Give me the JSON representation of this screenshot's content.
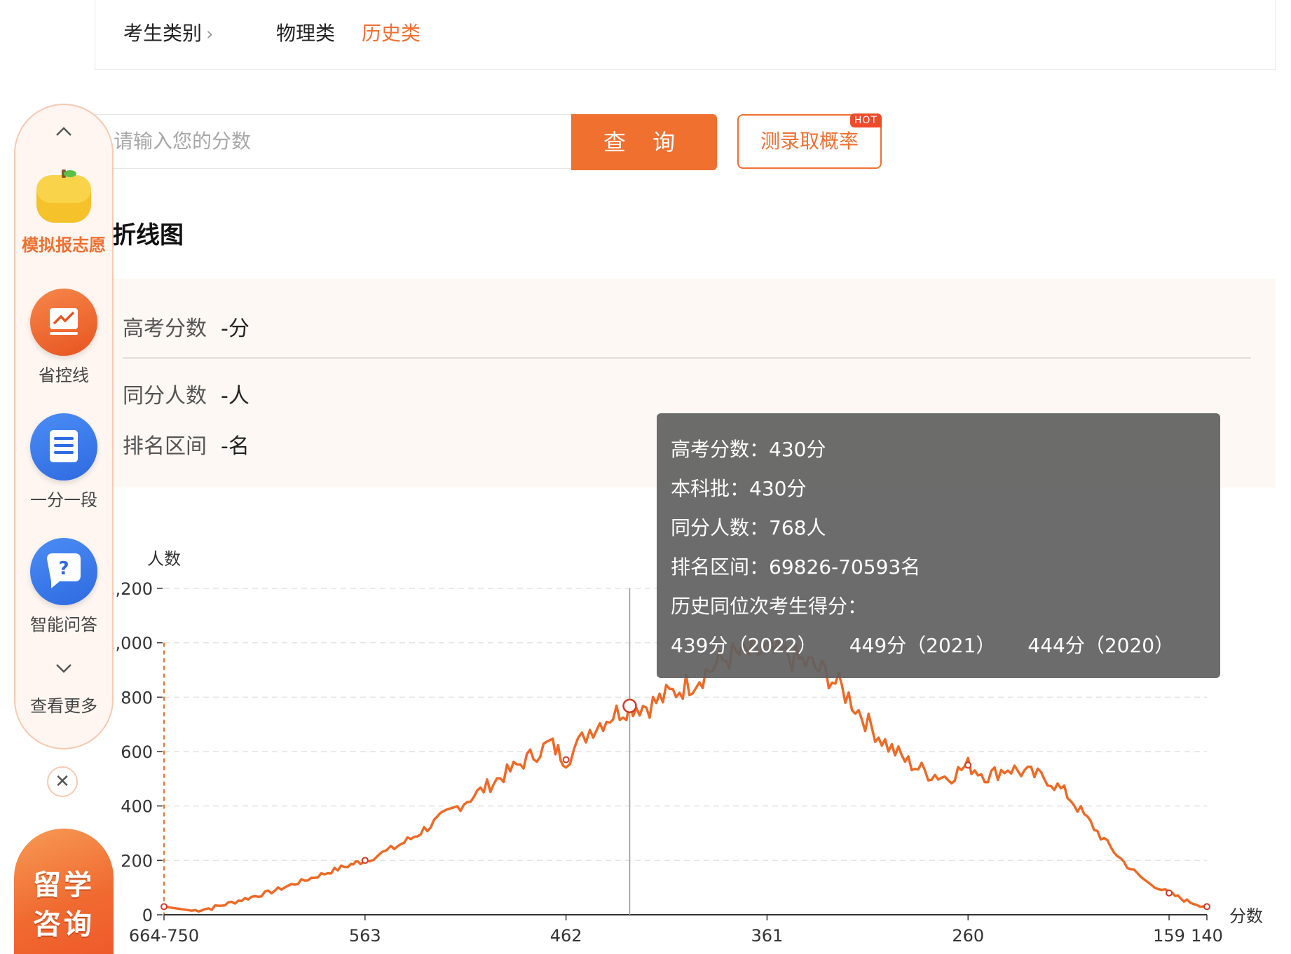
{
  "filter": {
    "label": "考生类别",
    "chevron": "›",
    "options": [
      "物理类",
      "历史类"
    ],
    "active_option": "历史类"
  },
  "search": {
    "placeholder": "请输入您的分数",
    "query_label": "查 询",
    "probability_label": "测录取概率",
    "hot_badge": "HOT"
  },
  "section_title": "折线图",
  "info": {
    "score_label": "高考分数",
    "score_value": "-分",
    "same_label": "同分人数",
    "same_value": "-人",
    "rank_label": "排名区间",
    "rank_value": "-名"
  },
  "tooltip": {
    "score": "高考分数：430分",
    "batch": "本科批：430分",
    "same": "同分人数：768人",
    "rank": "排名区间：69826-70593名",
    "history_title": "历史同位次考生得分：",
    "history": [
      "439分（2022）",
      "449分（2021）",
      "444分（2020）"
    ]
  },
  "sidebar": {
    "up_icon": "chevron-up-icon",
    "items": [
      {
        "label": "模拟报志愿",
        "icon": "orange-fruit-icon",
        "highlight": true
      },
      {
        "label": "省控线",
        "icon": "line-chart-icon",
        "highlight": false
      },
      {
        "label": "一分一段",
        "icon": "list-document-icon",
        "highlight": false
      },
      {
        "label": "智能问答",
        "icon": "question-bubble-icon",
        "highlight": false
      }
    ],
    "down_icon": "chevron-down-icon",
    "more_label": "查看更多",
    "close_icon": "close-icon",
    "study": [
      "留学",
      "咨询"
    ]
  },
  "colors": {
    "accent": "#f07030",
    "tooltip_bg": "#5f5f5f",
    "panel_bg": "#fdf8f3"
  },
  "chart_data": {
    "type": "line",
    "ylabel": "人数",
    "xlabel": "分数",
    "ylim": [
      0,
      1200
    ],
    "y_ticks": [
      "0",
      "200",
      "400",
      "600",
      "800",
      "1,000",
      "1,200"
    ],
    "x_ticks": [
      "664-750",
      "563",
      "462",
      "361",
      "260",
      "159",
      "140"
    ],
    "x": [
      664,
      650,
      640,
      630,
      620,
      610,
      600,
      590,
      580,
      570,
      563,
      550,
      540,
      530,
      520,
      510,
      500,
      490,
      480,
      470,
      462,
      450,
      440,
      430,
      420,
      410,
      400,
      390,
      380,
      370,
      361,
      350,
      340,
      330,
      320,
      310,
      300,
      290,
      280,
      270,
      260,
      250,
      240,
      230,
      220,
      210,
      200,
      190,
      180,
      170,
      159,
      150,
      140
    ],
    "values": [
      30,
      15,
      25,
      45,
      65,
      85,
      110,
      135,
      160,
      185,
      200,
      240,
      280,
      330,
      380,
      430,
      480,
      530,
      580,
      630,
      570,
      680,
      730,
      768,
      770,
      810,
      850,
      900,
      950,
      960,
      965,
      950,
      920,
      880,
      800,
      700,
      620,
      560,
      520,
      505,
      550,
      510,
      540,
      520,
      500,
      440,
      350,
      260,
      180,
      120,
      80,
      50,
      30
    ],
    "markers": [
      {
        "x": 664,
        "y": 30
      },
      {
        "x": 563,
        "y": 200
      },
      {
        "x": 462,
        "y": 570
      },
      {
        "x": 260,
        "y": 550
      },
      {
        "x": 159,
        "y": 80
      },
      {
        "x": 140,
        "y": 30
      }
    ],
    "highlight": {
      "x": 430,
      "y": 768
    },
    "grid": true
  }
}
